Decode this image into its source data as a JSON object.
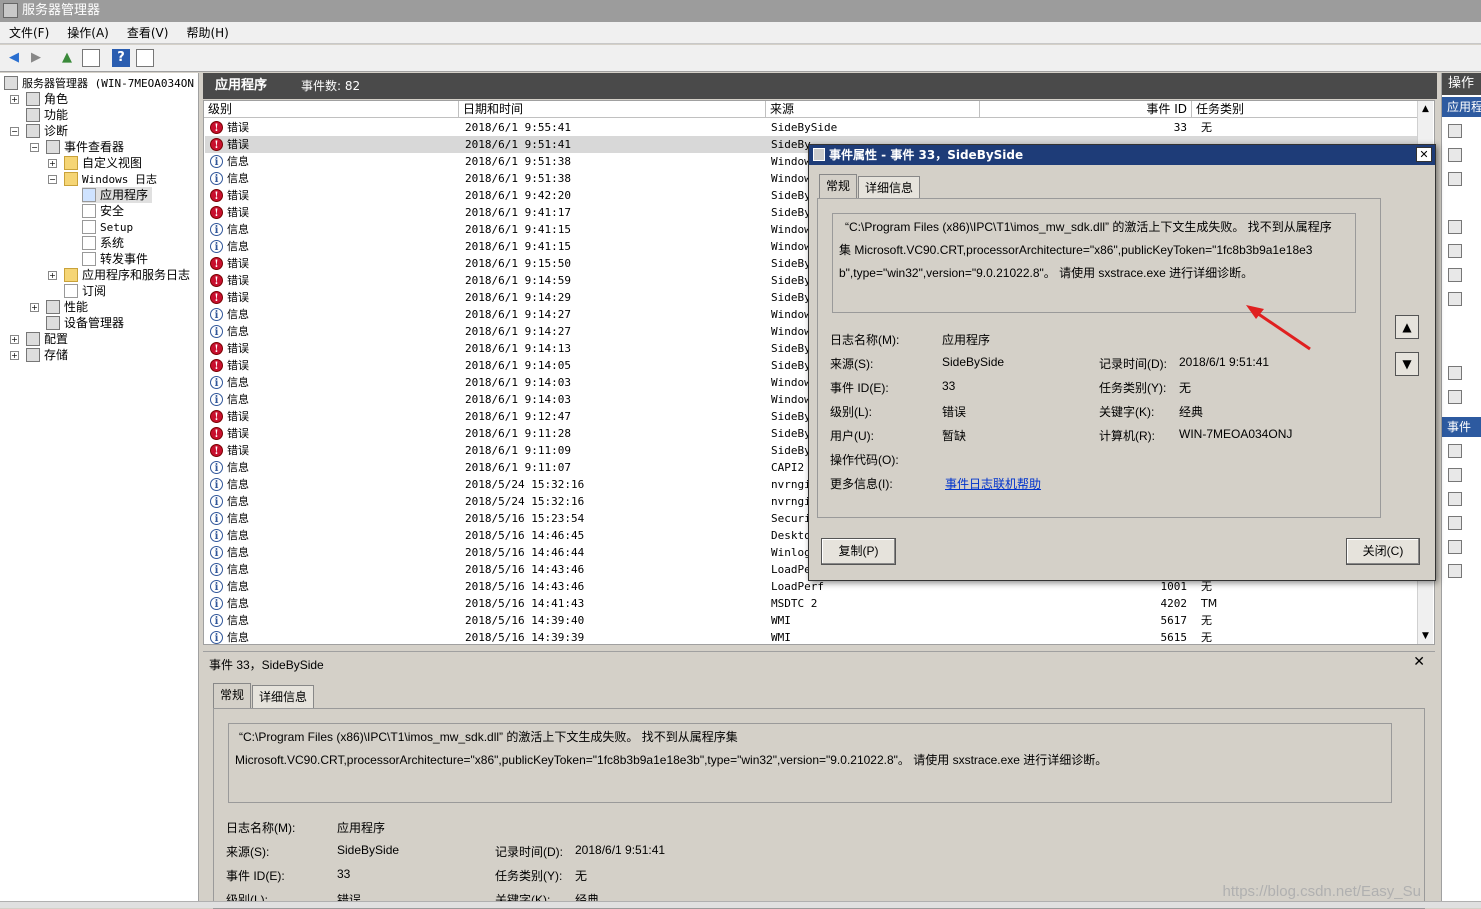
{
  "window": {
    "title": "服务器管理器"
  },
  "menu": [
    "文件(F)",
    "操作(A)",
    "查看(V)",
    "帮助(H)"
  ],
  "tree": {
    "root": "服务器管理器 (WIN-7MEOA034ON",
    "roles": "角色",
    "features": "功能",
    "diagnostics": "诊断",
    "event_viewer": "事件查看器",
    "custom_views": "自定义视图",
    "windows_logs": "Windows 日志",
    "application": "应用程序",
    "security": "安全",
    "setup": "Setup",
    "system": "系统",
    "forwarded": "转发事件",
    "app_service_logs": "应用程序和服务日志",
    "subscriptions": "订阅",
    "performance": "性能",
    "device_manager": "设备管理器",
    "configuration": "配置",
    "storage": "存储"
  },
  "log_header": {
    "title": "应用程序",
    "count_label": "事件数: 82"
  },
  "columns": {
    "level": "级别",
    "datetime": "日期和时间",
    "source": "来源",
    "event_id": "事件 ID",
    "task": "任务类别"
  },
  "rows": [
    {
      "level": "错误",
      "type": "err",
      "datetime": "2018/6/1 9:55:41",
      "source": "SideBySide",
      "event_id": "33",
      "task": "无",
      "selected": false
    },
    {
      "level": "错误",
      "type": "err",
      "datetime": "2018/6/1 9:51:41",
      "source": "SideBy",
      "event_id": "",
      "task": "",
      "selected": true
    },
    {
      "level": "信息",
      "type": "info",
      "datetime": "2018/6/1 9:51:38",
      "source": "Window",
      "event_id": "",
      "task": ""
    },
    {
      "level": "信息",
      "type": "info",
      "datetime": "2018/6/1 9:51:38",
      "source": "Window",
      "event_id": "",
      "task": ""
    },
    {
      "level": "错误",
      "type": "err",
      "datetime": "2018/6/1 9:42:20",
      "source": "SideBy",
      "event_id": "",
      "task": ""
    },
    {
      "level": "错误",
      "type": "err",
      "datetime": "2018/6/1 9:41:17",
      "source": "SideBy",
      "event_id": "",
      "task": ""
    },
    {
      "level": "信息",
      "type": "info",
      "datetime": "2018/6/1 9:41:15",
      "source": "Window",
      "event_id": "",
      "task": ""
    },
    {
      "level": "信息",
      "type": "info",
      "datetime": "2018/6/1 9:41:15",
      "source": "Window",
      "event_id": "",
      "task": ""
    },
    {
      "level": "错误",
      "type": "err",
      "datetime": "2018/6/1 9:15:50",
      "source": "SideBy",
      "event_id": "",
      "task": ""
    },
    {
      "level": "错误",
      "type": "err",
      "datetime": "2018/6/1 9:14:59",
      "source": "SideBy",
      "event_id": "",
      "task": ""
    },
    {
      "level": "错误",
      "type": "err",
      "datetime": "2018/6/1 9:14:29",
      "source": "SideBy",
      "event_id": "",
      "task": ""
    },
    {
      "level": "信息",
      "type": "info",
      "datetime": "2018/6/1 9:14:27",
      "source": "Window",
      "event_id": "",
      "task": ""
    },
    {
      "level": "信息",
      "type": "info",
      "datetime": "2018/6/1 9:14:27",
      "source": "Window",
      "event_id": "",
      "task": ""
    },
    {
      "level": "错误",
      "type": "err",
      "datetime": "2018/6/1 9:14:13",
      "source": "SideBy",
      "event_id": "",
      "task": ""
    },
    {
      "level": "错误",
      "type": "err",
      "datetime": "2018/6/1 9:14:05",
      "source": "SideBy",
      "event_id": "",
      "task": ""
    },
    {
      "level": "信息",
      "type": "info",
      "datetime": "2018/6/1 9:14:03",
      "source": "Window",
      "event_id": "",
      "task": ""
    },
    {
      "level": "信息",
      "type": "info",
      "datetime": "2018/6/1 9:14:03",
      "source": "Window",
      "event_id": "",
      "task": ""
    },
    {
      "level": "错误",
      "type": "err",
      "datetime": "2018/6/1 9:12:47",
      "source": "SideBy",
      "event_id": "",
      "task": ""
    },
    {
      "level": "错误",
      "type": "err",
      "datetime": "2018/6/1 9:11:28",
      "source": "SideBy",
      "event_id": "",
      "task": ""
    },
    {
      "level": "错误",
      "type": "err",
      "datetime": "2018/6/1 9:11:09",
      "source": "SideBy",
      "event_id": "",
      "task": ""
    },
    {
      "level": "信息",
      "type": "info",
      "datetime": "2018/6/1 9:11:07",
      "source": "CAPI2",
      "event_id": "",
      "task": ""
    },
    {
      "level": "信息",
      "type": "info",
      "datetime": "2018/5/24 15:32:16",
      "source": "nvrngi",
      "event_id": "",
      "task": ""
    },
    {
      "level": "信息",
      "type": "info",
      "datetime": "2018/5/24 15:32:16",
      "source": "nvrngi",
      "event_id": "",
      "task": ""
    },
    {
      "level": "信息",
      "type": "info",
      "datetime": "2018/5/16 15:23:54",
      "source": "Securi",
      "event_id": "",
      "task": ""
    },
    {
      "level": "信息",
      "type": "info",
      "datetime": "2018/5/16 14:46:45",
      "source": "Deskto",
      "event_id": "",
      "task": ""
    },
    {
      "level": "信息",
      "type": "info",
      "datetime": "2018/5/16 14:46:44",
      "source": "Winlog",
      "event_id": "",
      "task": ""
    },
    {
      "level": "信息",
      "type": "info",
      "datetime": "2018/5/16 14:43:46",
      "source": "LoadPe",
      "event_id": "",
      "task": ""
    },
    {
      "level": "信息",
      "type": "info",
      "datetime": "2018/5/16 14:43:46",
      "source": "LoadPerf",
      "event_id": "1001",
      "task": "无"
    },
    {
      "level": "信息",
      "type": "info",
      "datetime": "2018/5/16 14:41:43",
      "source": "MSDTC 2",
      "event_id": "4202",
      "task": "TM"
    },
    {
      "level": "信息",
      "type": "info",
      "datetime": "2018/5/16 14:39:40",
      "source": "WMI",
      "event_id": "5617",
      "task": "无"
    },
    {
      "level": "信息",
      "type": "info",
      "datetime": "2018/5/16 14:39:39",
      "source": "WMI",
      "event_id": "5615",
      "task": "无"
    }
  ],
  "dialog": {
    "title": "事件属性 - 事件 33，SideBySide",
    "tab_general": "常规",
    "tab_details": "详细信息",
    "desc_line1": "“C:\\Program Files (x86)\\IPC\\T1\\imos_mw_sdk.dll” 的激活上下文生成失败。 找不到从属程序",
    "desc_line2": "集 Microsoft.VC90.CRT,processorArchitecture=\"x86\",publicKeyToken=\"1fc8b3b9a1e18e3",
    "desc_line3": "b\",type=\"win32\",version=\"9.0.21022.8\"。 请使用 sxstrace.exe 进行详细诊断。",
    "log_name_label": "日志名称(M):",
    "log_name": "应用程序",
    "source_label": "来源(S):",
    "source": "SideBySide",
    "logged_label": "记录时间(D):",
    "logged": "2018/6/1 9:51:41",
    "event_id_label": "事件 ID(E):",
    "event_id": "33",
    "task_label": "任务类别(Y):",
    "task": "无",
    "level_label": "级别(L):",
    "level": "错误",
    "keywords_label": "关键字(K):",
    "keywords": "经典",
    "user_label": "用户(U):",
    "user": "暂缺",
    "computer_label": "计算机(R):",
    "computer": "WIN-7MEOA034ONJ",
    "opcode_label": "操作代码(O):",
    "more_info_label": "更多信息(I):",
    "more_info_link": "事件日志联机帮助",
    "copy_button": "复制(P)",
    "close_button": "关闭(C)"
  },
  "preview": {
    "title": "事件 33，SideBySide",
    "tab_general": "常规",
    "tab_details": "详细信息",
    "desc_line1": "“C:\\Program Files (x86)\\IPC\\T1\\imos_mw_sdk.dll” 的激活上下文生成失败。 找不到从属程序集",
    "desc_line2": "Microsoft.VC90.CRT,processorArchitecture=\"x86\",publicKeyToken=\"1fc8b3b9a1e18e3b\",type=\"win32\",version=\"9.0.21022.8\"。 请使用 sxstrace.exe 进行详细诊断。",
    "log_name_label": "日志名称(M):",
    "log_name": "应用程序",
    "source_label": "来源(S):",
    "source": "SideBySide",
    "logged_label": "记录时间(D):",
    "logged": "2018/6/1 9:51:41",
    "event_id_label": "事件 ID(E):",
    "event_id": "33",
    "task_label": "任务类别(Y):",
    "task": "无",
    "level_label": "级别(L):",
    "level": "错误",
    "keywords_label": "关键字(K):",
    "keywords": "经典"
  },
  "actions": {
    "header": "操作",
    "section1": "应用程",
    "section2": "事件"
  },
  "watermark": "https://blog.csdn.net/Easy_Su"
}
